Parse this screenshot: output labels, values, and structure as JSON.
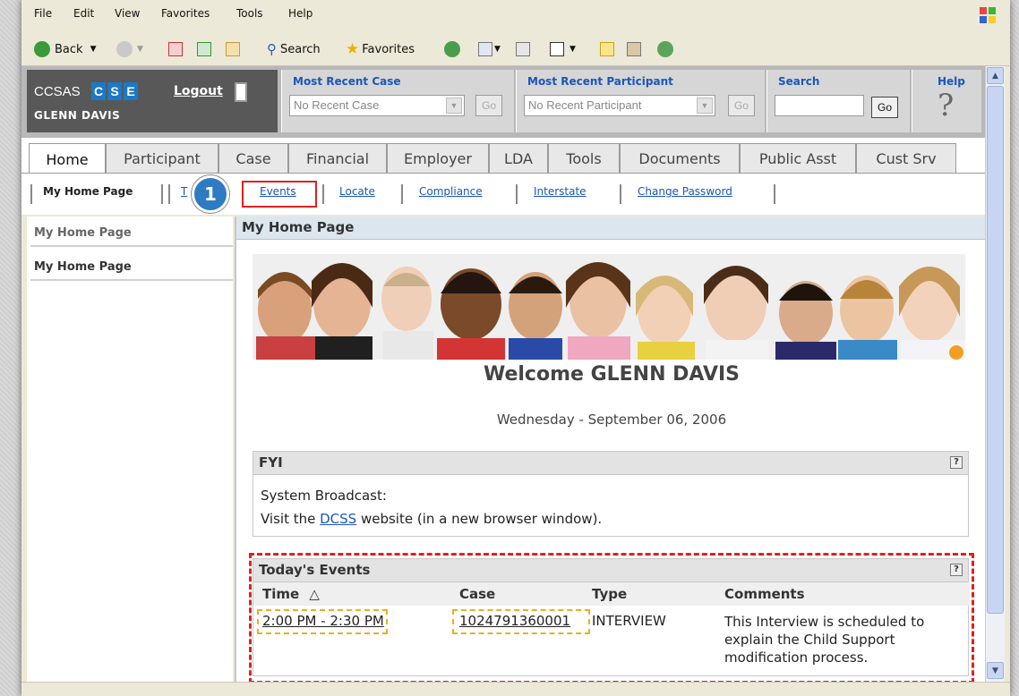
{
  "menu": [
    "File",
    "Edit",
    "View",
    "Favorites",
    "Tools",
    "Help"
  ],
  "toolbar": {
    "back": "Back",
    "search": "Search",
    "favorites": "Favorites"
  },
  "header": {
    "app_name": "CCSAS",
    "app_mark": [
      "C",
      "S",
      "E"
    ],
    "user": "GLENN DAVIS",
    "logout": "Logout",
    "recent_case": {
      "label": "Most Recent Case",
      "value": "No Recent Case",
      "go": "Go"
    },
    "recent_participant": {
      "label": "Most Recent Participant",
      "value": "No Recent Participant",
      "go": "Go"
    },
    "search": {
      "label": "Search",
      "go": "Go"
    },
    "help": {
      "label": "Help",
      "glyph": "?"
    }
  },
  "tabs": [
    "Home",
    "Participant",
    "Case",
    "Financial",
    "Employer",
    "LDA",
    "Tools",
    "Documents",
    "Public Asst",
    "Cust Srv"
  ],
  "subnav": {
    "items": [
      "My Home Page",
      "T",
      "Events",
      "Locate",
      "Compliance",
      "Interstate",
      "Change Password"
    ],
    "step_badge": "1"
  },
  "leftnav": [
    "My Home Page",
    "My Home Page"
  ],
  "main": {
    "title": "My Home Page",
    "welcome": "Welcome GLENN DAVIS",
    "date": "Wednesday - September 06, 2006"
  },
  "fyi": {
    "title": "FYI",
    "line1": "System Broadcast:",
    "line2_prefix": "Visit the ",
    "line2_link": "DCSS",
    "line2_suffix": " website (in a new browser window)."
  },
  "events": {
    "title": "Today's Events",
    "columns": [
      "Time",
      "Case",
      "Type",
      "Comments"
    ],
    "sort_glyph": "△",
    "rows": [
      {
        "time": "2:00 PM - 2:30 PM",
        "case": "1024791360001",
        "type": "INTERVIEW",
        "comments": [
          "This Interview is scheduled to",
          "explain the Child Support",
          "modification process."
        ]
      }
    ]
  },
  "colors": {
    "link": "#1b56b8",
    "highlight_red": "#e02020",
    "highlight_yellow": "#e6b020",
    "badge_blue": "#2e7bc4",
    "brand_blue": "#1b79c7"
  }
}
